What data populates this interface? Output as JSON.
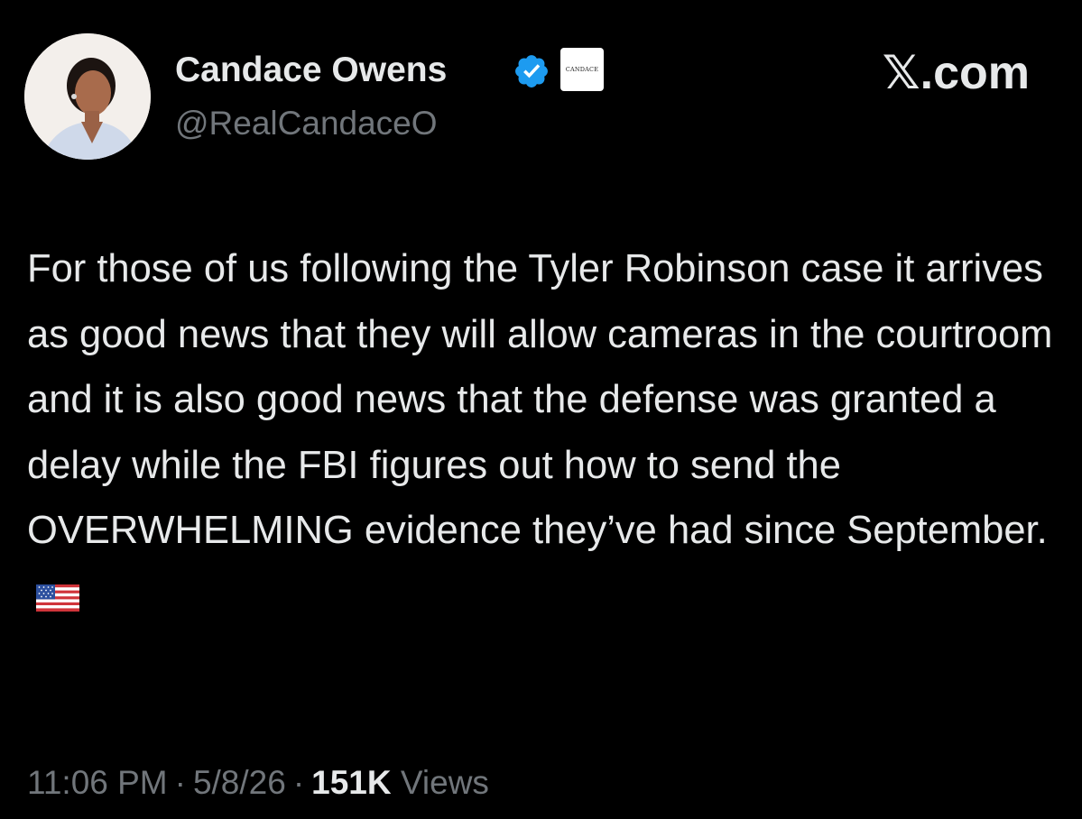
{
  "tweet": {
    "author": {
      "display_name": "Candace Owens",
      "handle": "@RealCandaceO",
      "verified": true,
      "verified_icon": "verified-badge-icon",
      "affiliate_label": "CANDACE"
    },
    "brand": "𝕏.com",
    "body": "For those of us following the Tyler Robinson case it arrives as good news that they will allow cameras in the courtroom and it is also good news that the defense was granted a delay while the FBI figures out how to send the OVERWHELMING evidence they’ve  had since September.",
    "emoji": "us-flag-icon",
    "meta": {
      "time": "11:06 PM",
      "date": "5/8/26",
      "separator": "·",
      "views_count": "151K",
      "views_label": "Views"
    }
  },
  "colors": {
    "background": "#000000",
    "text_primary": "#e7e9ea",
    "text_secondary": "#71767b",
    "verified_blue": "#1d9bf0"
  }
}
